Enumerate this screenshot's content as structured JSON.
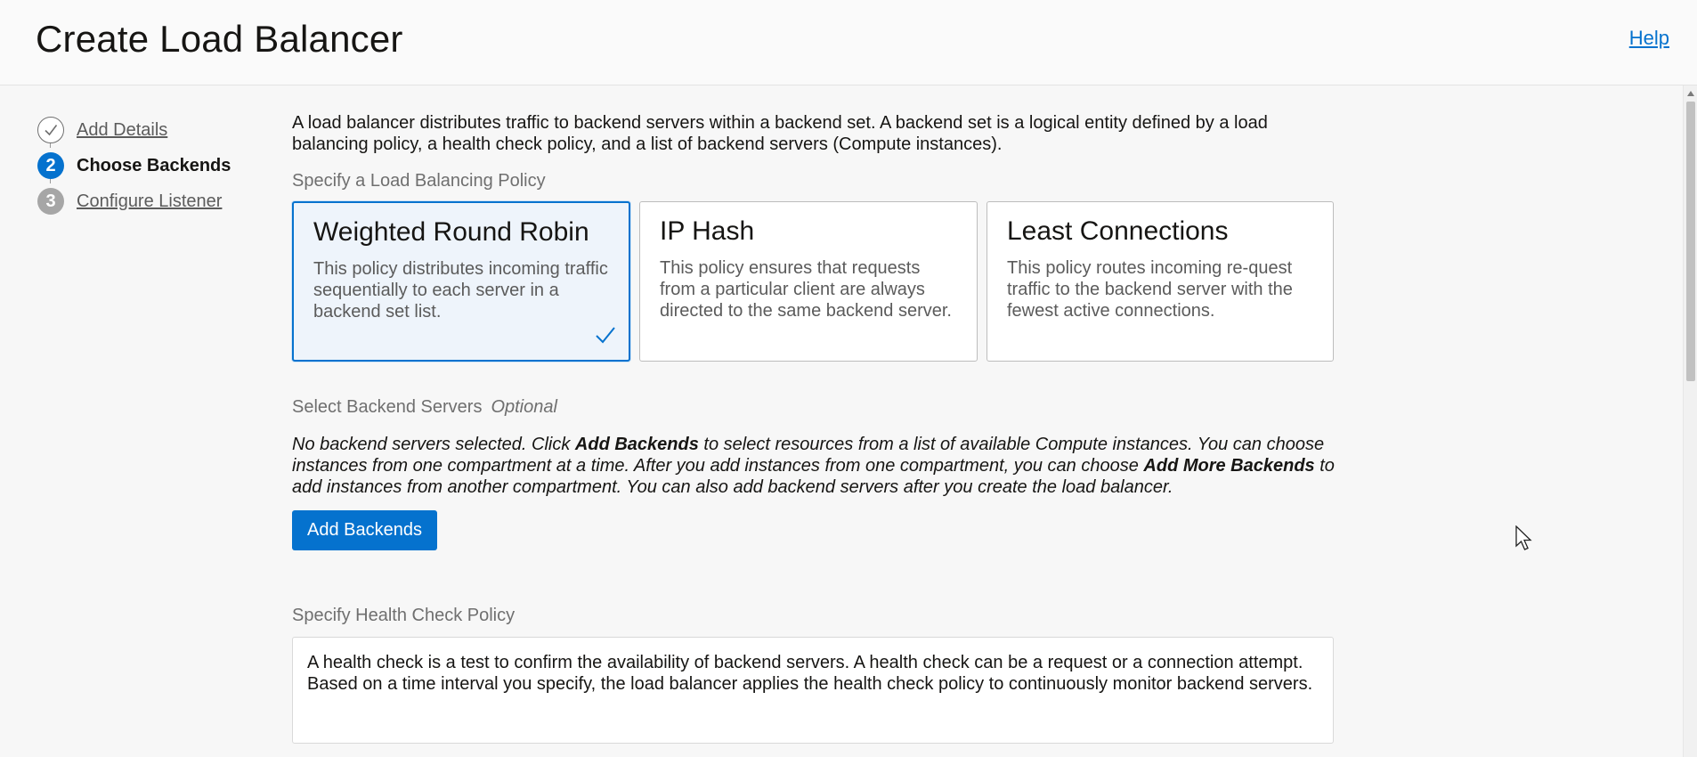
{
  "header": {
    "title": "Create Load Balancer",
    "help_label": "Help"
  },
  "steps": [
    {
      "number": "",
      "label": "Add Details",
      "state": "done",
      "icon": "check-icon"
    },
    {
      "number": "2",
      "label": "Choose Backends",
      "state": "active"
    },
    {
      "number": "3",
      "label": "Configure Listener",
      "state": "todo"
    }
  ],
  "main": {
    "intro": "A load balancer distributes traffic to backend servers within a backend set. A backend set is a logical entity defined by a load balancing policy, a health check policy, and a list of backend servers (Compute instances).",
    "policy_section_label": "Specify a Load Balancing Policy",
    "policies": [
      {
        "title": "Weighted Round Robin",
        "description": "This policy distributes incoming traffic sequentially to each server in a backend set list.",
        "selected": true
      },
      {
        "title": "IP Hash",
        "description": "This policy ensures that requests from a particular client are always directed to the same backend server.",
        "selected": false
      },
      {
        "title": "Least Connections",
        "description": "This policy routes incoming re-quest traffic to the backend server with the fewest active connections.",
        "selected": false
      }
    ],
    "backend_section_label": "Select Backend Servers",
    "backend_optional": "Optional",
    "backend_text": {
      "part1": "No backend servers selected. Click ",
      "bold1": "Add Backends",
      "part2": " to select resources from a list of available Compute instances. You can choose instances from one compartment at a time. After you add instances from one compartment, you can choose ",
      "bold2": "Add More Backends",
      "part3": " to add instances from another compartment. You can also add backend servers after you create the load balancer."
    },
    "add_backends_button": "Add Backends",
    "health_section_label": "Specify Health Check Policy",
    "health_text": "A health check is a test to confirm the availability of backend servers. A health check can be a request or a connection attempt. Based on a time interval you specify, the load balancer applies the health check policy to continuously monitor backend servers."
  },
  "colors": {
    "accent": "#0572ce",
    "selected_card_bg": "#eef4fb",
    "page_bg": "#f7f7f7"
  }
}
